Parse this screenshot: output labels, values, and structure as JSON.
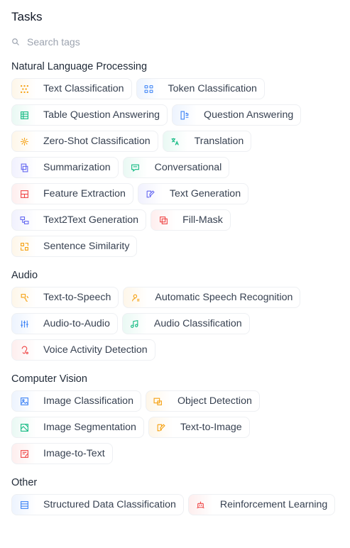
{
  "title": "Tasks",
  "search": {
    "placeholder": "Search tags"
  },
  "sections": [
    {
      "title": "Natural Language Processing",
      "tags": [
        {
          "label": "Text Classification",
          "icon": "text-classification-icon",
          "color": "#f59e0b"
        },
        {
          "label": "Token Classification",
          "icon": "token-classification-icon",
          "color": "#3b82f6"
        },
        {
          "label": "Table Question Answering",
          "icon": "table-icon",
          "color": "#10b981"
        },
        {
          "label": "Question Answering",
          "icon": "question-answering-icon",
          "color": "#3b82f6"
        },
        {
          "label": "Zero-Shot Classification",
          "icon": "zero-shot-icon",
          "color": "#f59e0b"
        },
        {
          "label": "Translation",
          "icon": "translation-icon",
          "color": "#10b981"
        },
        {
          "label": "Summarization",
          "icon": "summarization-icon",
          "color": "#6366f1"
        },
        {
          "label": "Conversational",
          "icon": "chat-icon",
          "color": "#10b981"
        },
        {
          "label": "Feature Extraction",
          "icon": "feature-extraction-icon",
          "color": "#ef4444"
        },
        {
          "label": "Text Generation",
          "icon": "text-generation-icon",
          "color": "#6366f1"
        },
        {
          "label": "Text2Text Generation",
          "icon": "text2text-icon",
          "color": "#6366f1"
        },
        {
          "label": "Fill-Mask",
          "icon": "fill-mask-icon",
          "color": "#ef4444"
        },
        {
          "label": "Sentence Similarity",
          "icon": "sentence-similarity-icon",
          "color": "#f59e0b"
        }
      ]
    },
    {
      "title": "Audio",
      "tags": [
        {
          "label": "Text-to-Speech",
          "icon": "text-to-speech-icon",
          "color": "#f59e0b"
        },
        {
          "label": "Automatic Speech Recognition",
          "icon": "speech-recognition-icon",
          "color": "#f59e0b"
        },
        {
          "label": "Audio-to-Audio",
          "icon": "audio-to-audio-icon",
          "color": "#3b82f6"
        },
        {
          "label": "Audio Classification",
          "icon": "music-note-icon",
          "color": "#10b981"
        },
        {
          "label": "Voice Activity Detection",
          "icon": "voice-activity-icon",
          "color": "#ef4444"
        }
      ]
    },
    {
      "title": "Computer Vision",
      "tags": [
        {
          "label": "Image Classification",
          "icon": "image-classification-icon",
          "color": "#3b82f6"
        },
        {
          "label": "Object Detection",
          "icon": "object-detection-icon",
          "color": "#f59e0b"
        },
        {
          "label": "Image Segmentation",
          "icon": "image-segmentation-icon",
          "color": "#10b981"
        },
        {
          "label": "Text-to-Image",
          "icon": "text-to-image-icon",
          "color": "#f59e0b"
        },
        {
          "label": "Image-to-Text",
          "icon": "image-to-text-icon",
          "color": "#ef4444"
        }
      ]
    },
    {
      "title": "Other",
      "tags": [
        {
          "label": "Structured Data Classification",
          "icon": "structured-data-icon",
          "color": "#3b82f6"
        },
        {
          "label": "Reinforcement Learning",
          "icon": "robot-icon",
          "color": "#ef4444"
        }
      ]
    }
  ]
}
